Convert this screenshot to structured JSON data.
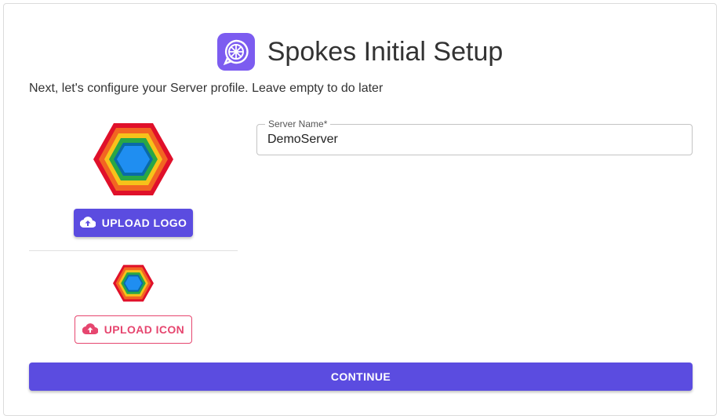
{
  "header": {
    "title": "Spokes Initial Setup",
    "app_icon": "wheel-chat-icon"
  },
  "intro": {
    "text": "Next, let's configure your Server profile. Leave empty to do later"
  },
  "logo_section": {
    "logo_image": "hexagon-rainbow-logo",
    "upload_logo_label": "UPLOAD LOGO",
    "upload_icon_symbol": "cloud-upload-icon"
  },
  "icon_section": {
    "icon_image": "hexagon-rainbow-icon",
    "upload_icon_label": "UPLOAD ICON"
  },
  "server_name_field": {
    "label": "Server Name*",
    "value": "DemoServer"
  },
  "actions": {
    "continue_label": "CONTINUE"
  },
  "colors": {
    "primary": "#5b4ce0",
    "secondary": "#e6466f",
    "app_icon_bg": "#7c5cf0"
  }
}
